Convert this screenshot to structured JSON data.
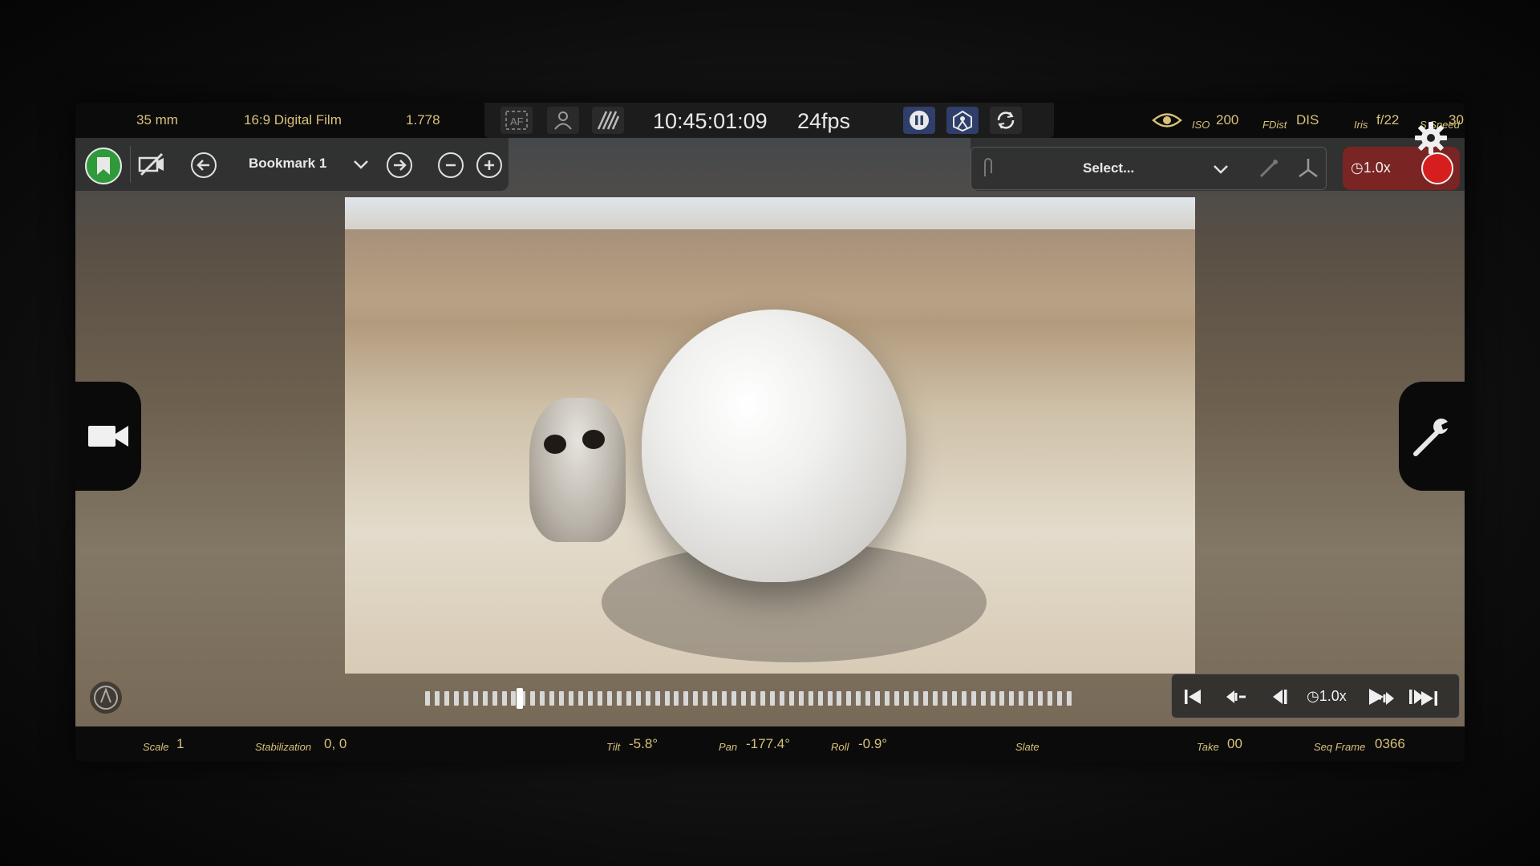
{
  "topbar": {
    "focal_length": "35 mm",
    "format": "16:9 Digital Film",
    "aspect": "1.778",
    "timecode": "10:45:01:09",
    "fps": "24fps",
    "iso_label": "ISO",
    "iso_value": "200",
    "fdist_label": "FDist",
    "fdist_value": "DIS",
    "iris_label": "Iris",
    "iris_value": "f/22",
    "sspeed_label": "S Speed",
    "sspeed_value": "30"
  },
  "toolbar": {
    "bookmark_label": "Bookmark 1",
    "select_placeholder": "Select...",
    "speed_label": "1.0x"
  },
  "transport": {
    "speed_label": "1.0x",
    "playhead_position": 0.14,
    "tick_count": 68
  },
  "bottombar": {
    "scale_label": "Scale",
    "scale_value": "1",
    "stabilization_label": "Stabilization",
    "stabilization_value": "0, 0",
    "tilt_label": "Tilt",
    "tilt_value": "-5.8°",
    "pan_label": "Pan",
    "pan_value": "-177.4°",
    "roll_label": "Roll",
    "roll_value": "-0.9°",
    "slate_label": "Slate",
    "take_label": "Take",
    "take_value": "00",
    "seqframe_label": "Seq Frame",
    "seqframe_value": "0366"
  },
  "colors": {
    "accent_gold": "#d8c07a",
    "record_red": "#d61e1e",
    "bookmark_green": "#2e9a3a",
    "active_blue": "#2f3e6a"
  },
  "icons": [
    "bookmark-icon",
    "hide-camera-icon",
    "prev-bookmark-icon",
    "chevron-down-icon",
    "next-bookmark-icon",
    "zoom-out-icon",
    "zoom-in-icon",
    "af-icon",
    "person-icon",
    "hatch-icon",
    "pause-icon",
    "tracking-icon",
    "sync-icon",
    "eye-icon",
    "settings-gear-icon",
    "video-camera-icon",
    "wrench-icon",
    "skip-start-icon",
    "step-back-icon",
    "frame-back-icon",
    "play-icon",
    "frame-forward-icon",
    "step-forward-icon",
    "skip-end-icon",
    "record-icon"
  ]
}
